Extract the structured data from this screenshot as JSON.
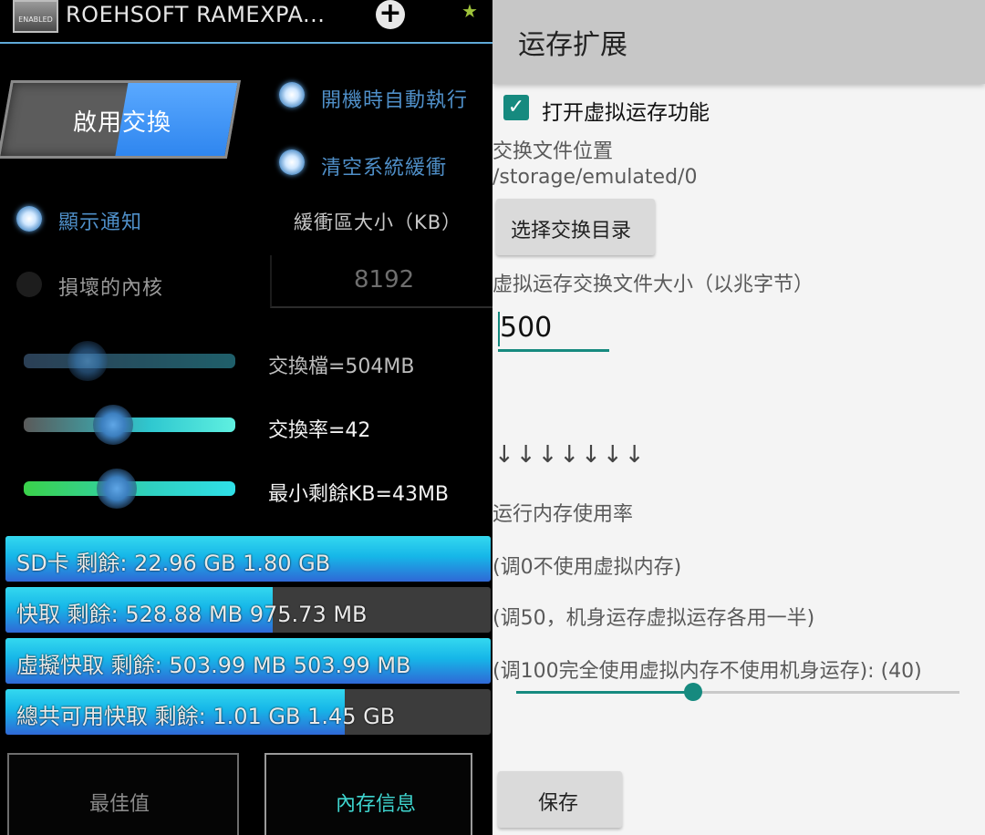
{
  "left_app": {
    "title": "ROEHSOFT RAMEXPA...",
    "logo_text": "ENABLED",
    "add_icon": "+",
    "star_icon": "★",
    "swap_toggle": {
      "label": "啟用交換",
      "on": true
    },
    "options": {
      "autorun": {
        "label": "開機時自動執行",
        "checked": true
      },
      "clear_cache": {
        "label": "清空系統緩衝",
        "checked": true
      },
      "show_notification": {
        "label": "顯示通知",
        "checked": true
      },
      "broken_kernel": {
        "label": "損壞的內核",
        "checked": false
      }
    },
    "buffer": {
      "label": "緩衝區大小（KB）",
      "value": "8192"
    },
    "sliders": [
      {
        "label": "交換檔=504MB",
        "level": 0.3
      },
      {
        "label": "交換率=42",
        "level": 0.42
      },
      {
        "label": "最小剩餘KB=43MB",
        "level": 0.45
      }
    ],
    "bars": [
      {
        "text": "SD卡 剩餘: 22.96 GB 1.80 GB",
        "fill": 1.0
      },
      {
        "text": "快取 剩餘: 528.88 MB 975.73 MB",
        "fill": 0.55
      },
      {
        "text": "虛擬快取 剩餘: 503.99 MB 503.99 MB",
        "fill": 1.0
      },
      {
        "text": "總共可用快取 剩餘: 1.01 GB 1.45 GB",
        "fill": 0.7
      }
    ],
    "buttons": {
      "best": "最佳值",
      "memory_info": "內存信息"
    }
  },
  "right_app": {
    "title": "运存扩展",
    "enable_checkbox": {
      "label": "打开虚拟运存功能",
      "checked": true
    },
    "swap_location_label": "交换文件位置",
    "swap_location_path": "/storage/emulated/0",
    "choose_dir_button": "选择交换目录",
    "swap_size_label": "虚拟运存交换文件大小（以兆字节）",
    "swap_size_value": "500",
    "arrows": "↓↓↓↓↓↓↓",
    "usage_label": "运行内存使用率",
    "hint_0": "(调0不使用虚拟内存)",
    "hint_50": "(调50，机身运存虚拟运存各用一半)",
    "hint_100": "(调100完全使用虚拟内存不使用机身运存): (40)",
    "usage_percent": 40,
    "save_button": "保存",
    "accent_color": "#168a7f"
  }
}
